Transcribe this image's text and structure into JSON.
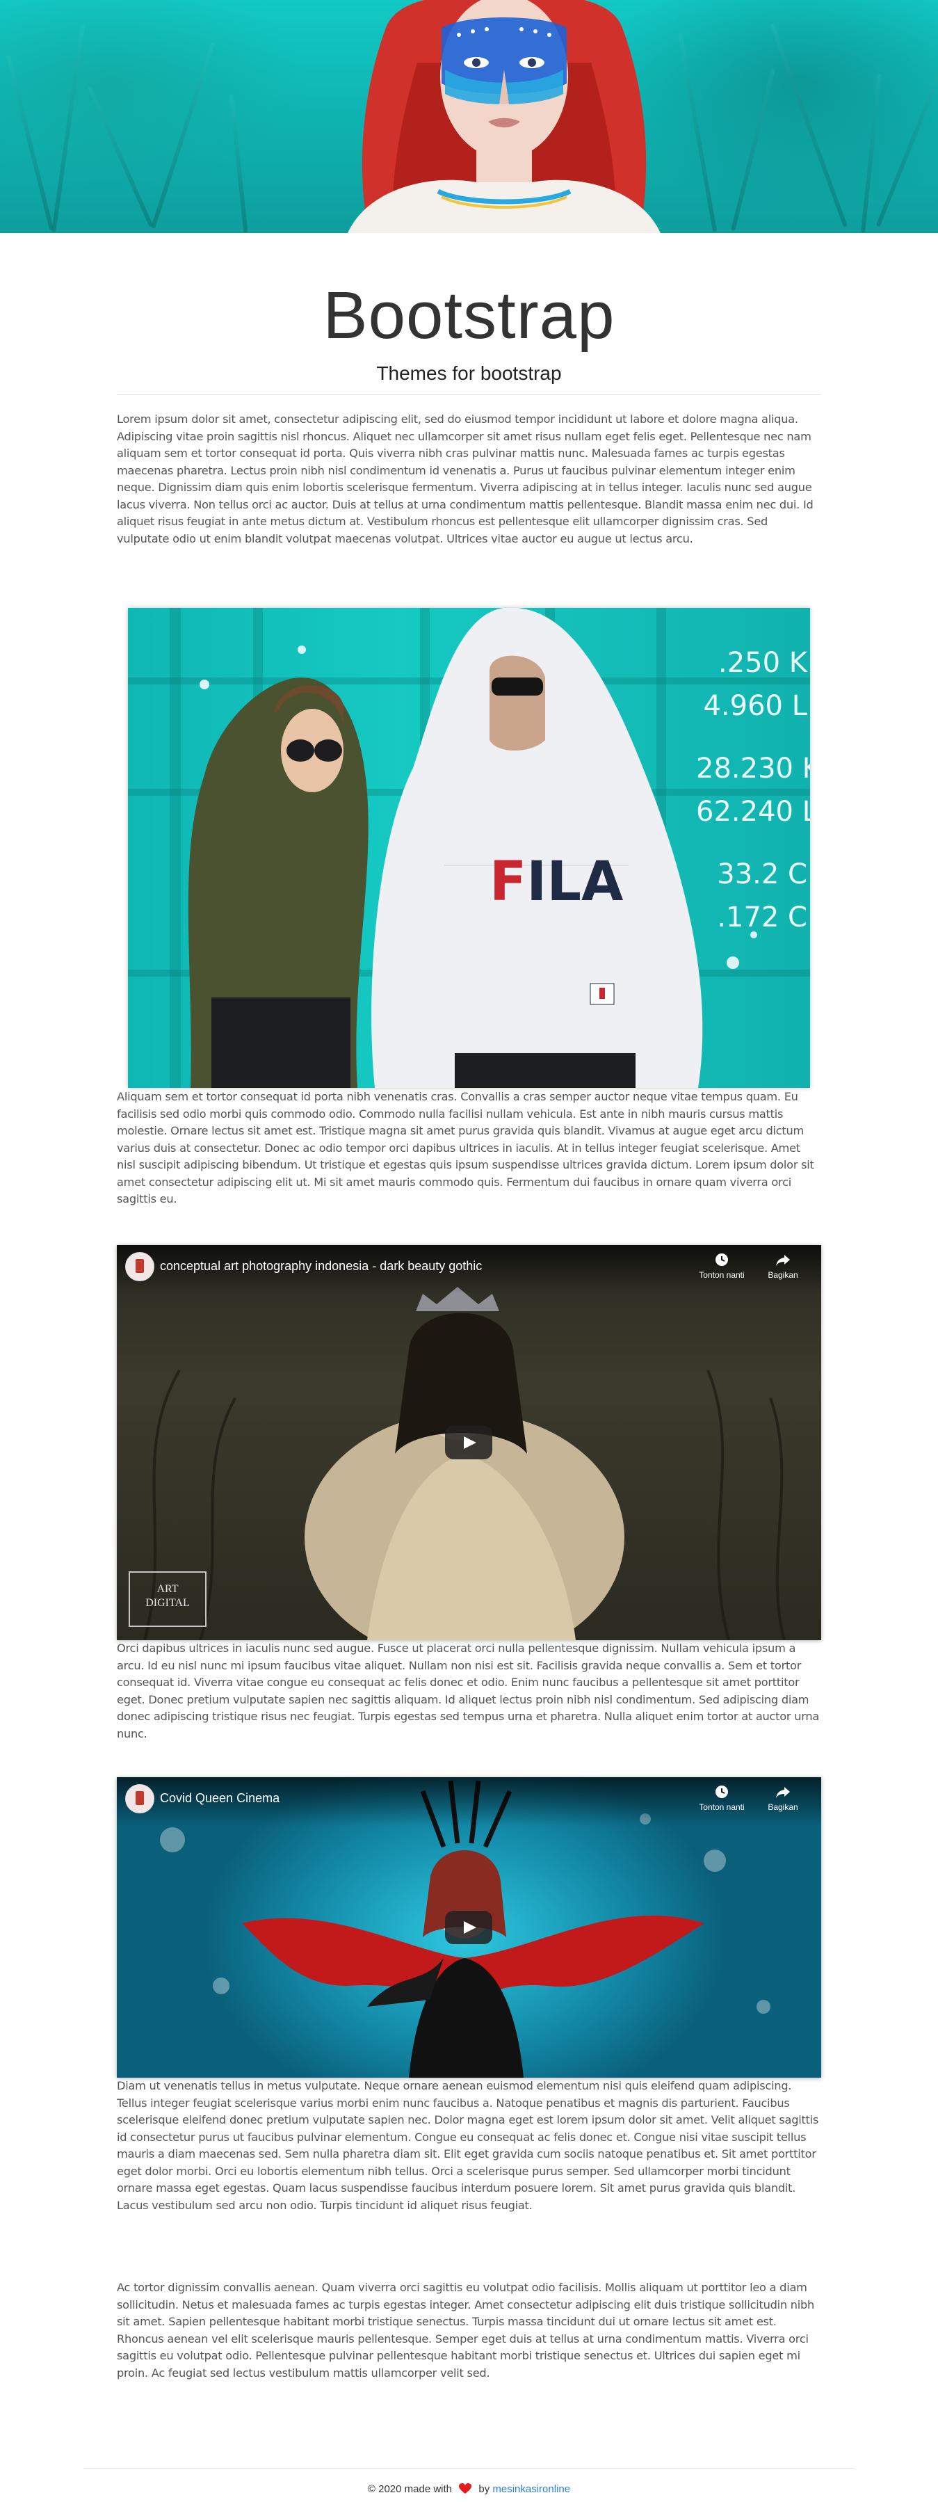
{
  "header": {
    "title": "Bootstrap",
    "subtitle": "Themes for bootstrap"
  },
  "paragraphs": [
    "Lorem ipsum dolor sit amet, consectetur adipiscing elit, sed do eiusmod tempor incididunt ut labore et dolore magna aliqua. Adipiscing vitae proin sagittis nisl rhoncus. Aliquet nec ullamcorper sit amet risus nullam eget felis eget. Pellentesque nec nam aliquam sem et tortor consequat id porta. Quis viverra nibh cras pulvinar mattis nunc. Malesuada fames ac turpis egestas maecenas pharetra. Lectus proin nibh nisl condimentum id venenatis a. Purus ut faucibus pulvinar elementum integer enim neque. Dignissim diam quis enim lobortis scelerisque fermentum. Viverra adipiscing at in tellus integer. Iaculis nunc sed augue lacus viverra. Non tellus orci ac auctor. Duis at tellus at urna condimentum mattis pellentesque. Blandit massa enim nec dui. Id aliquet risus feugiat in ante metus dictum at. Vestibulum rhoncus est pellentesque elit ullamcorper dignissim cras. Sed vulputate odio ut enim blandit volutpat maecenas volutpat. Ultrices vitae auctor eu augue ut lectus arcu.",
    "Aliquam sem et tortor consequat id porta nibh venenatis cras. Convallis a cras semper auctor neque vitae tempus quam. Eu facilisis sed odio morbi quis commodo odio. Commodo nulla facilisi nullam vehicula. Est ante in nibh mauris cursus mattis molestie. Ornare lectus sit amet est. Tristique magna sit amet purus gravida quis blandit. Vivamus at augue eget arcu dictum varius duis at consectetur. Donec ac odio tempor orci dapibus ultrices in iaculis. At in tellus integer feugiat scelerisque. Amet nisl suscipit adipiscing bibendum. Ut tristique et egestas quis ipsum suspendisse ultrices gravida dictum. Lorem ipsum dolor sit amet consectetur adipiscing elit ut. Mi sit amet mauris commodo quis. Fermentum dui faucibus in ornare quam viverra orci sagittis eu.",
    "Orci dapibus ultrices in iaculis nunc sed augue. Fusce ut placerat orci nulla pellentesque dignissim. Nullam vehicula ipsum a arcu. Id eu nisl nunc mi ipsum faucibus vitae aliquet. Nullam non nisi est sit. Facilisis gravida neque convallis a. Sem et tortor consequat id. Viverra vitae congue eu consequat ac felis donec et odio. Enim nunc faucibus a pellentesque sit amet porttitor eget. Donec pretium vulputate sapien nec sagittis aliquam. Id aliquet lectus proin nibh nisl condimentum. Sed adipiscing diam donec adipiscing tristique risus nec feugiat. Turpis egestas sed tempus urna et pharetra. Nulla aliquet enim tortor at auctor urna nunc.",
    "Diam ut venenatis tellus in metus vulputate. Neque ornare aenean euismod elementum nisi quis eleifend quam adipiscing. Tellus integer feugiat scelerisque varius morbi enim nunc faucibus a. Natoque penatibus et magnis dis parturient. Faucibus scelerisque eleifend donec pretium vulputate sapien nec. Dolor magna eget est lorem ipsum dolor sit amet. Velit aliquet sagittis id consectetur purus ut faucibus pulvinar elementum. Congue eu consequat ac felis donec et. Congue nisi vitae suscipit tellus mauris a diam maecenas sed. Sem nulla pharetra diam sit. Elit eget gravida cum sociis natoque penatibus et. Sit amet porttitor eget dolor morbi. Orci eu lobortis elementum nibh tellus. Orci a scelerisque purus semper. Sed ullamcorper morbi tincidunt ornare massa eget egestas. Quam lacus suspendisse faucibus interdum posuere lorem. Sit amet purus gravida quis blandit. Lacus vestibulum sed arcu non odio. Turpis tincidunt id aliquet risus feugiat.",
    "Ac tortor dignissim convallis aenean. Quam viverra orci sagittis eu volutpat odio facilisis. Mollis aliquam ut porttitor leo a diam sollicitudin. Netus et malesuada fames ac turpis egestas integer. Amet consectetur adipiscing elit duis tristique sollicitudin nibh sit amet. Sapien pellentesque habitant morbi tristique senectus. Turpis massa tincidunt dui ut ornare lectus sit amet est. Rhoncus aenean vel elit scelerisque mauris pellentesque. Semper eget duis at tellus at urna condimentum mattis. Viverra orci sagittis eu volutpat odio. Pellentesque pulvinar pellentesque habitant morbi tristique senectus et. Ultrices dui sapien eget mi proin. Ac feugiat sed lectus vestibulum mattis ullamcorper velit sed."
  ],
  "photo": {
    "container_numbers": [
      ".250 K",
      "4.960 L",
      "28.230 K",
      "62.240 L",
      "33.2 C",
      ".172 C"
    ],
    "hoodie_text": "FILA"
  },
  "videos": [
    {
      "title": "conceptual art photography indonesia - dark beauty gothic",
      "watch_later": "Tonton nanti",
      "share": "Bagikan",
      "watermark_line1": "ART",
      "watermark_line2": "DIGITAL"
    },
    {
      "title": "Covid Queen Cinema",
      "watch_later": "Tonton nanti",
      "share": "Bagikan"
    }
  ],
  "footer": {
    "text_before": "© 2020 made with",
    "text_by": "by",
    "link": "mesinkasironline"
  },
  "colors": {
    "accent_teal": "#12c9c5",
    "link_blue": "#2a7de1",
    "heart_red": "#e11d1d"
  }
}
